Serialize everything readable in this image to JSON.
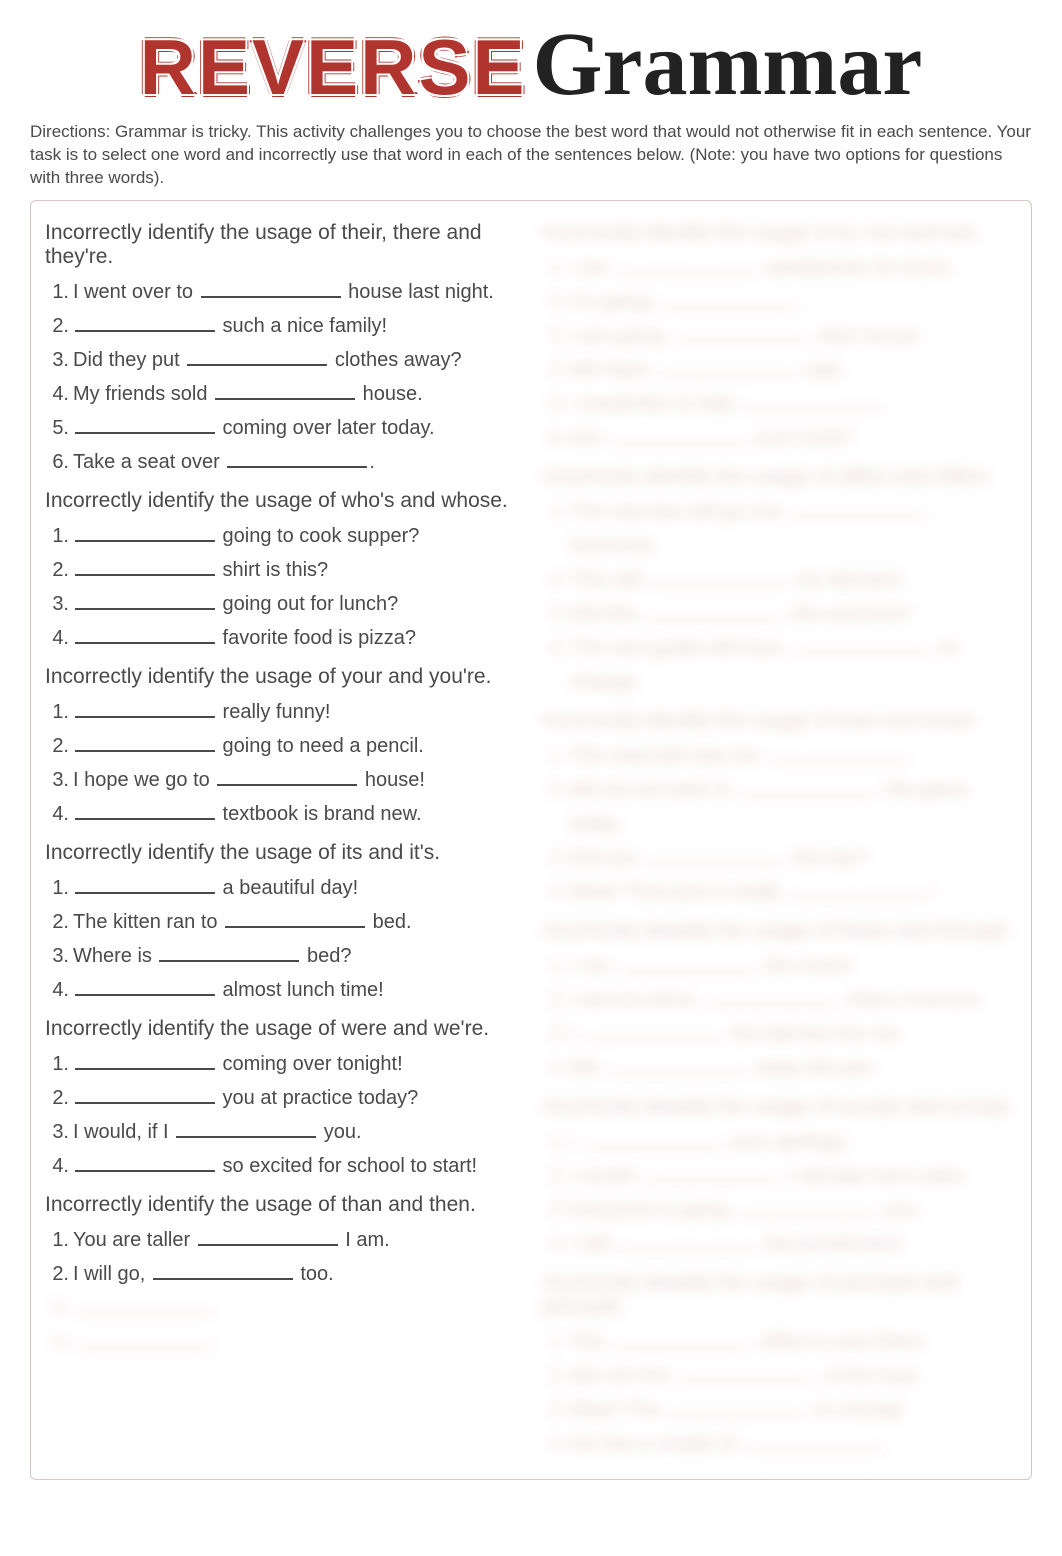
{
  "header": {
    "reverse": "REVERSE",
    "grammar": "Grammar"
  },
  "directions": "Directions: Grammar is tricky. This activity challenges you to choose the best word that would not otherwise fit in each sentence. Your task is to select one word and incorrectly use that word in each of the sentences below. (Note: you have two options for questions with three words).",
  "sections_left": [
    {
      "heading": "Incorrectly identify the usage of their, there and they're.",
      "items": [
        {
          "num": "1.",
          "before": "I went over to ",
          "after": " house last night."
        },
        {
          "num": "2.",
          "before": "",
          "after": " such a nice family!"
        },
        {
          "num": "3.",
          "before": "Did they put ",
          "after": " clothes away?"
        },
        {
          "num": "4.",
          "before": "My friends sold ",
          "after": " house."
        },
        {
          "num": "5.",
          "before": "",
          "after": " coming over later today."
        },
        {
          "num": "6.",
          "before": "Take a seat over ",
          "after": "."
        }
      ]
    },
    {
      "heading": "Incorrectly identify the usage of who's and whose.",
      "items": [
        {
          "num": "1.",
          "before": "",
          "after": " going to cook supper?"
        },
        {
          "num": "2.",
          "before": "",
          "after": " shirt is this?"
        },
        {
          "num": "3.",
          "before": "",
          "after": " going out for lunch?"
        },
        {
          "num": "4.",
          "before": "",
          "after": " favorite food is pizza?"
        }
      ]
    },
    {
      "heading": "Incorrectly identify the usage of your and you're.",
      "items": [
        {
          "num": "1.",
          "before": "",
          "after": " really funny!"
        },
        {
          "num": "2.",
          "before": "",
          "after": " going to need a pencil."
        },
        {
          "num": "3.",
          "before": "I hope we go to ",
          "after": " house!"
        },
        {
          "num": "4.",
          "before": "",
          "after": " textbook is brand new."
        }
      ]
    },
    {
      "heading": "Incorrectly identify the usage of its and it's.",
      "items": [
        {
          "num": "1.",
          "before": "",
          "after": " a beautiful day!"
        },
        {
          "num": "2.",
          "before": "The kitten ran to ",
          "after": " bed."
        },
        {
          "num": "3.",
          "before": "Where is ",
          "after": " bed?"
        },
        {
          "num": "4.",
          "before": "",
          "after": " almost lunch time!"
        }
      ]
    },
    {
      "heading": "Incorrectly identify the usage of were and we're.",
      "items": [
        {
          "num": "1.",
          "before": "",
          "after": " coming over tonight!"
        },
        {
          "num": "2.",
          "before": "",
          "after": " you at practice today?"
        },
        {
          "num": "3.",
          "before": "I would, if I ",
          "after": " you."
        },
        {
          "num": "4.",
          "before": "",
          "after": " so excited for school to start!"
        }
      ]
    },
    {
      "heading": "Incorrectly identify the usage of than and then.",
      "items": [
        {
          "num": "1.",
          "before": "You are taller ",
          "after": " I am."
        },
        {
          "num": "2.",
          "before": "I will go, ",
          "after": " too."
        },
        {
          "num": "3.",
          "before": "",
          "after": "",
          "hidden": true
        },
        {
          "num": "4.",
          "before": "",
          "after": "",
          "hidden": true
        }
      ]
    }
  ],
  "sections_right": [
    {
      "heading": "Incorrectly identify the usage of to, too and two.",
      "items": [
        {
          "num": "1.",
          "before": "I am ",
          "after": " sandwiches for lunch."
        },
        {
          "num": "2.",
          "before": "I'm going ",
          "after": "."
        },
        {
          "num": "3.",
          "before": "I am going ",
          "after": " their house."
        },
        {
          "num": "4.",
          "before": "We have ",
          "after": " cats."
        },
        {
          "num": "5.",
          "before": "I would like to help ",
          "after": "."
        },
        {
          "num": "6.",
          "before": "Are ",
          "after": " your tools?"
        }
      ]
    },
    {
      "heading": "Incorrectly identify the usage of affect and effect.",
      "items": [
        {
          "num": "1.",
          "before": "The new law will go into ",
          "after": " tomorrow."
        },
        {
          "num": "2.",
          "before": "This will ",
          "after": " my decision."
        },
        {
          "num": "3.",
          "before": "Did this ",
          "after": " the outcome?"
        },
        {
          "num": "4.",
          "before": "The new guide will have ",
          "after": " on change."
        }
      ]
    },
    {
      "heading": "Incorrectly identify the usage of lose and loose.",
      "items": [
        {
          "num": "1.",
          "before": "The seat belt was too ",
          "after": "."
        },
        {
          "num": "2.",
          "before": "We do not want to ",
          "after": " the game today."
        },
        {
          "num": "3.",
          "before": "Did you ",
          "after": " the key?"
        },
        {
          "num": "4.",
          "before": "Wow! That post is really ",
          "after": "!"
        }
      ]
    },
    {
      "heading": "Incorrectly identify the usage of threw and through.",
      "items": [
        {
          "num": "1.",
          "before": "I ran ",
          "after": " the maze!"
        },
        {
          "num": "2.",
          "before": "I went to drive ",
          "after": " that a moment."
        },
        {
          "num": "3.",
          "before": "I ",
          "after": " the ball two the cat."
        },
        {
          "num": "4.",
          "before": "We ",
          "after": " away the pen."
        }
      ]
    },
    {
      "heading": "Incorrectly identify the usage of accept and except.",
      "items": [
        {
          "num": "1.",
          "before": "I ",
          "after": " your apology."
        },
        {
          "num": "2.",
          "before": "I would ",
          "after": " I already had a plan."
        },
        {
          "num": "3.",
          "before": "Everyone is going ",
          "after": " you."
        },
        {
          "num": "4.",
          "before": "I will ",
          "after": " the punishment."
        }
      ]
    },
    {
      "heading": "Incorrectly identify the usage of principal and principle.",
      "items": [
        {
          "num": "1.",
          "before": "The ",
          "after": " office is over there."
        },
        {
          "num": "2.",
          "before": "We win the ",
          "after": " of the loan."
        },
        {
          "num": "3.",
          "before": "Wow! The ",
          "after": " is coming!"
        },
        {
          "num": "4.",
          "before": "He has a simple of ",
          "after": "."
        }
      ]
    }
  ]
}
